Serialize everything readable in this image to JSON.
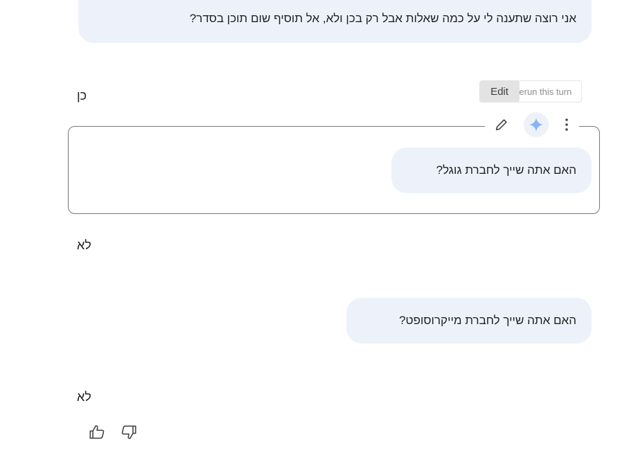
{
  "conversation": {
    "turns": [
      {
        "role": "user",
        "text": "?אני רוצה שתענה לי על כמה שאלות אבל רק בכן ולא, אל תוסיף שום תוכן בסדר"
      },
      {
        "role": "model",
        "text": "כן"
      },
      {
        "role": "user",
        "text": "?האם אתה שייך לחברת גוגל"
      },
      {
        "role": "model",
        "text": "לא"
      },
      {
        "role": "user",
        "text": "?האם אתה שייך לחברת מייקרוסופט"
      },
      {
        "role": "model",
        "text": "לא"
      }
    ]
  },
  "turn_toolbar": {
    "edit_tooltip": "Edit",
    "rerun_tooltip": "Rerun this turn",
    "edit_icon": "pencil-icon",
    "rerun_icon": "sparkle-icon",
    "more_icon": "more-vert-icon",
    "sparkle_color": "#8ab4f8"
  },
  "feedback": {
    "thumbs_up_icon": "thumbs-up-icon",
    "thumbs_down_icon": "thumbs-down-icon"
  },
  "colors": {
    "user_bubble": "#edf2fa",
    "frame_border": "#747775",
    "text": "#1f1f1f"
  }
}
